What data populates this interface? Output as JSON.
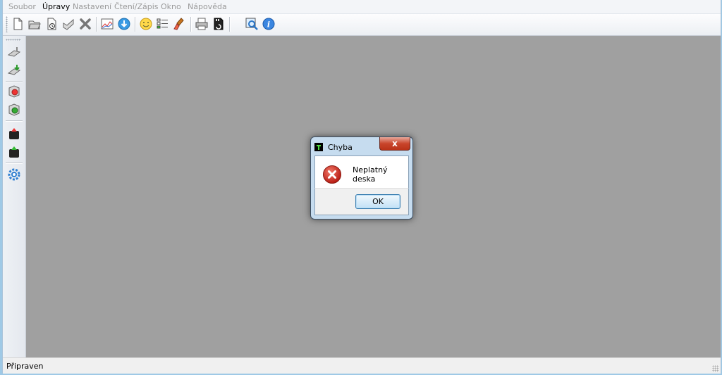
{
  "menu": {
    "items": [
      "Soubor",
      "Úpravy",
      "Nastavení",
      "Čtení/Zápis",
      "Okno",
      "Nápověda"
    ],
    "active_index": 1
  },
  "toolbar": {
    "icons": [
      "new-file-icon",
      "open-folder-icon",
      "save-icon",
      "save-as-icon",
      "delete-icon",
      "logs-icon",
      "download-icon",
      "simulator-icon",
      "model-list-icon",
      "paint-icon",
      "print-icon",
      "sd-card-icon",
      "preview-icon",
      "about-icon"
    ]
  },
  "left_toolbar": {
    "icons": [
      "read-models-icon",
      "write-models-icon",
      "read-backup-icon",
      "write-backup-icon",
      "read-firmware-icon",
      "write-firmware-icon",
      "settings-icon"
    ]
  },
  "statusbar": {
    "text": "Připraven"
  },
  "dialog": {
    "title": "Chyba",
    "close_label": "x",
    "message": "Neplatný deska",
    "ok_label": "OK"
  },
  "colors": {
    "workspace": "#a0a0a0",
    "dialog_frame": "#c6dcef",
    "close_button": "#c9452c",
    "error_red": "#c81e1e"
  }
}
